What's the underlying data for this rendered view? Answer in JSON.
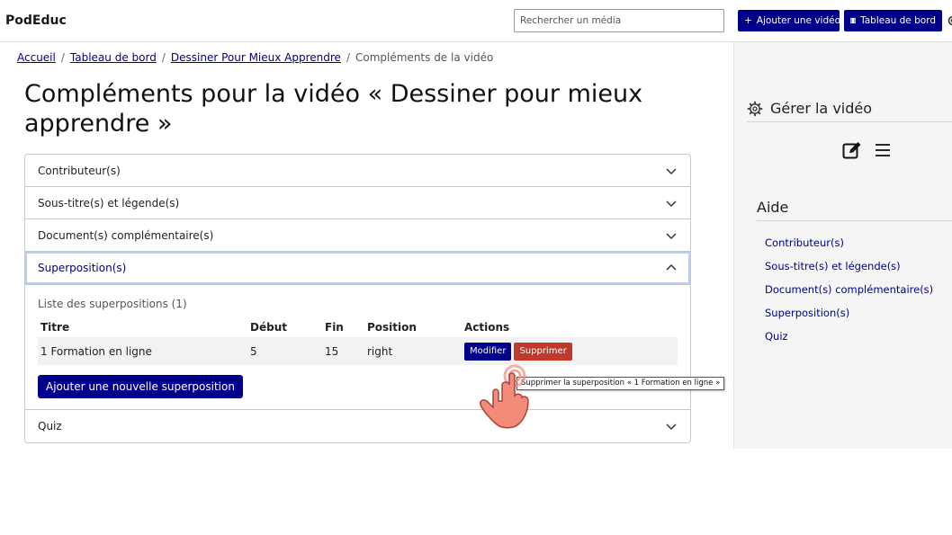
{
  "header": {
    "brand": "PodEduc",
    "search_placeholder": "Rechercher un média",
    "add_video_label": "Ajouter une vidéo",
    "dashboard_label": "Tableau de bord"
  },
  "breadcrumb": [
    "Accueil",
    "Tableau de bord",
    "Dessiner Pour Mieux Apprendre",
    "Compléments de la vidéo"
  ],
  "breadcrumb_sep": "/",
  "page_title": "Compléments pour la vidéo « Dessiner pour mieux apprendre »",
  "accordion": {
    "contributors": "Contributeur(s)",
    "subtitles": "Sous-titre(s) et légende(s)",
    "documents": "Document(s) complémentaire(s)",
    "overlays": "Superposition(s)",
    "quiz": "Quiz"
  },
  "overlays": {
    "list_caption": "Liste des superpositions (1)",
    "columns": [
      "Titre",
      "Début",
      "Fin",
      "Position",
      "Actions"
    ],
    "rows": [
      {
        "title": "1 Formation en ligne",
        "start": "5",
        "end": "15",
        "position": "right"
      }
    ],
    "edit_label": "Modifier",
    "delete_label": "Supprimer",
    "add_label": "Ajouter une nouvelle superposition",
    "tooltip": "Supprimer la superposition « 1 Formation en ligne »"
  },
  "sidebar": {
    "manage_title": "Gérer la vidéo",
    "help_title": "Aide",
    "help_links": [
      "Contributeur(s)",
      "Sous-titre(s) et légende(s)",
      "Document(s) complémentaire(s)",
      "Superposition(s)",
      "Quiz"
    ]
  },
  "colors": {
    "primary": "#00008b",
    "danger": "#c0392b",
    "sidebar_bg": "#f5f5f5"
  },
  "icons": [
    "plus-icon",
    "film-icon",
    "gear-icon",
    "chevron-down-icon",
    "chevron-up-icon",
    "edit-icon",
    "menu-icon",
    "pointer-hand-icon"
  ]
}
